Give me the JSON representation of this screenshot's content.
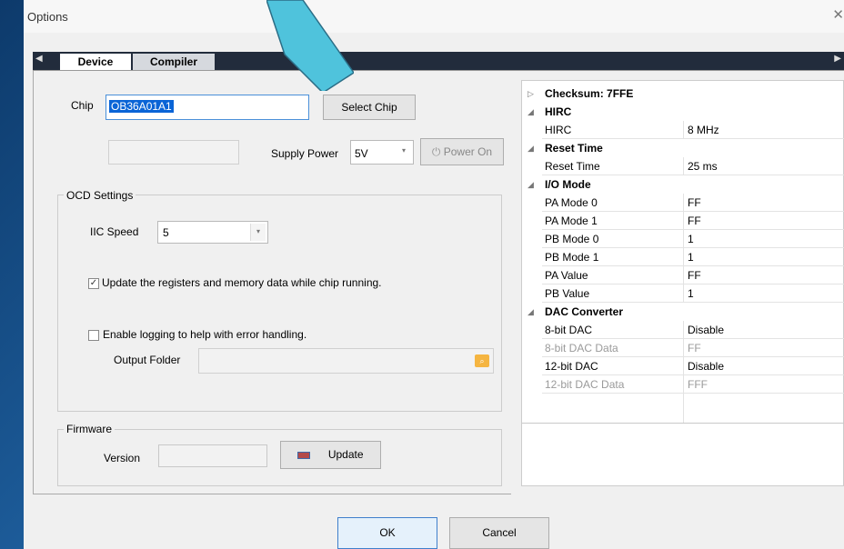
{
  "window": {
    "title": "Options",
    "close_glyph": "✕"
  },
  "tabs": [
    {
      "label": "Device"
    },
    {
      "label": "Compiler"
    }
  ],
  "device": {
    "chip_label": "Chip",
    "chip_value": "OB36A01A1",
    "select_chip_label": "Select Chip",
    "supply_power_label": "Supply Power",
    "supply_power_value": "5V",
    "power_on_label": "Power On",
    "ocd": {
      "title": "OCD Settings",
      "iic_speed_label": "IIC Speed",
      "iic_speed_value": "5",
      "update_registers_label": "Update the registers and memory data while chip running.",
      "update_registers_checked": true,
      "enable_logging_label": "Enable logging to help with error handling.",
      "enable_logging_checked": false,
      "output_folder_label": "Output Folder"
    },
    "firmware": {
      "title": "Firmware",
      "version_label": "Version",
      "update_label": "Update"
    }
  },
  "properties": {
    "checksum": "Checksum: 7FFE",
    "rows": [
      {
        "type": "category",
        "name": "HIRC"
      },
      {
        "type": "item",
        "name": "HIRC",
        "value": "8 MHz"
      },
      {
        "type": "category",
        "name": "Reset Time"
      },
      {
        "type": "item",
        "name": "Reset Time",
        "value": "25 ms"
      },
      {
        "type": "category",
        "name": "I/O Mode"
      },
      {
        "type": "item",
        "name": "PA Mode 0",
        "value": "FF"
      },
      {
        "type": "item",
        "name": "PA Mode 1",
        "value": "FF"
      },
      {
        "type": "item",
        "name": "PB Mode 0",
        "value": "1"
      },
      {
        "type": "item",
        "name": "PB Mode 1",
        "value": "1"
      },
      {
        "type": "item",
        "name": "PA Value",
        "value": "FF"
      },
      {
        "type": "item",
        "name": "PB Value",
        "value": "1"
      },
      {
        "type": "category",
        "name": "DAC Converter"
      },
      {
        "type": "item",
        "name": "8-bit DAC",
        "value": "Disable"
      },
      {
        "type": "item",
        "name": "8-bit DAC Data",
        "value": "FF",
        "disabled": true
      },
      {
        "type": "item",
        "name": "12-bit DAC",
        "value": "Disable"
      },
      {
        "type": "item",
        "name": "12-bit DAC Data",
        "value": "FFF",
        "disabled": true
      }
    ]
  },
  "footer": {
    "ok_label": "OK",
    "cancel_label": "Cancel"
  },
  "colors": {
    "accent_arrow": "#4fc3dc",
    "selection": "#0a64d6",
    "tab_strip": "#222c3c"
  }
}
